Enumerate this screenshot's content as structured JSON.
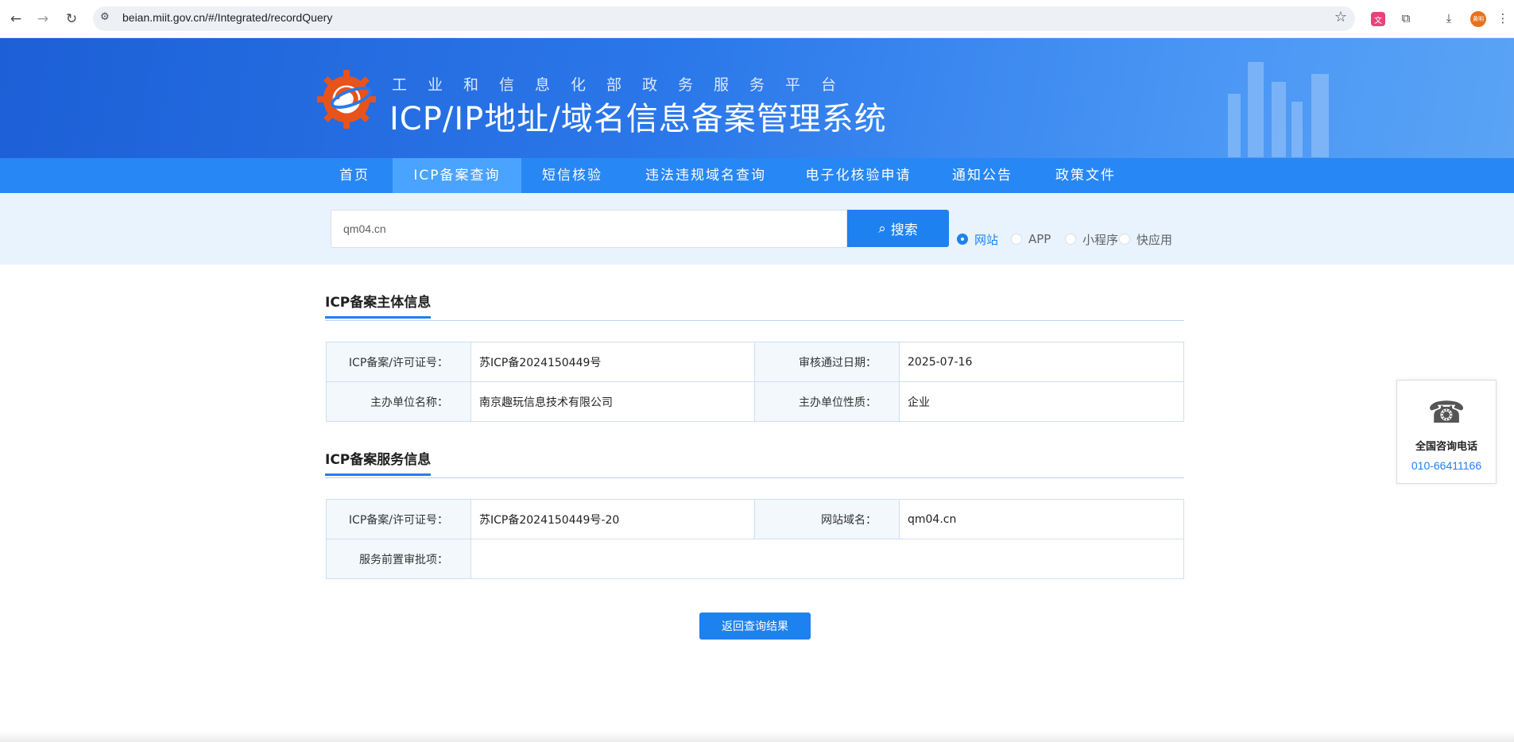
{
  "browser": {
    "url": "beian.miit.gov.cn/#/Integrated/recordQuery",
    "back_icon": "←",
    "forward_icon": "→",
    "reload_icon": "↻",
    "tune_icon": "⚙",
    "star_icon": "☆",
    "translate_icon": "文",
    "extensions_icon": "⧉",
    "download_icon": "⤓",
    "avatar_text": "黄明",
    "menu_icon": "⋮"
  },
  "header": {
    "subtitle": "工业和信息化部政务服务平台",
    "title": "ICP/IP地址/域名信息备案管理系统"
  },
  "nav": {
    "items": [
      {
        "label": "首页"
      },
      {
        "label": "ICP备案查询"
      },
      {
        "label": "短信核验"
      },
      {
        "label": "违法违规域名查询"
      },
      {
        "label": "电子化核验申请"
      },
      {
        "label": "通知公告"
      },
      {
        "label": "政策文件"
      }
    ],
    "active_index": 1
  },
  "search": {
    "value": "qm04.cn",
    "button_label": "搜索",
    "search_icon": "⌕",
    "options": [
      {
        "label": "网站",
        "checked": true
      },
      {
        "label": "APP",
        "checked": false
      },
      {
        "label": "小程序",
        "checked": false
      },
      {
        "label": "快应用",
        "checked": false
      }
    ]
  },
  "subject_info": {
    "title": "ICP备案主体信息",
    "rows": [
      {
        "l1": "ICP备案/许可证号：",
        "v1": "苏ICP备2024150449号",
        "l2": "审核通过日期：",
        "v2": "2025-07-16"
      },
      {
        "l1": "主办单位名称：",
        "v1": "南京趣玩信息技术有限公司",
        "l2": "主办单位性质：",
        "v2": "企业"
      }
    ]
  },
  "service_info": {
    "title": "ICP备案服务信息",
    "row1": {
      "l1": "ICP备案/许可证号：",
      "v1": "苏ICP备2024150449号-20",
      "l2": "网站域名：",
      "v2": "qm04.cn"
    },
    "row2": {
      "l1": "服务前置审批项：",
      "v1": ""
    }
  },
  "back_button": "返回查询结果",
  "contact": {
    "phone_icon": "☎",
    "label": "全国咨询电话",
    "number": "010-66411166"
  },
  "colors": {
    "primary": "#1e81f0",
    "nav_bg": "#2787f5",
    "nav_active": "#4aa3ff",
    "band": "#e8f3fd"
  }
}
